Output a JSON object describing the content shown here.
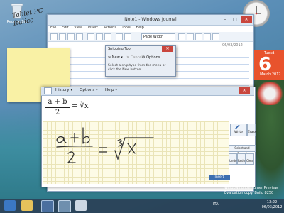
{
  "desktop": {
    "recycle_bin_label": "Recycle Bin",
    "sticky_note": [
      "Tablet PC",
      "Italico"
    ]
  },
  "journal": {
    "title": "Note1 - Windows Journal",
    "menu": [
      "File",
      "Edit",
      "View",
      "Insert",
      "Actions",
      "Tools",
      "Help"
    ],
    "zoom": "Page Width",
    "date": "06/03/2012"
  },
  "snipping_tool": {
    "title": "Snipping Tool",
    "new_label": "New",
    "cancel_label": "Cancel",
    "options_label": "Options",
    "description": "Select a snip type from the menu or click the New button."
  },
  "math_input": {
    "menu": [
      "History",
      "Options",
      "Help"
    ],
    "preview": {
      "numerator": "a + b",
      "denominator": "2",
      "rhs": "= ∛x"
    },
    "write_label": "Write",
    "erase_label": "Erase",
    "select_correct_label": "Select and Correct",
    "undo_label": "Undo",
    "redo_label": "Redo",
    "clear_label": "Clear",
    "insert_label": "Insert"
  },
  "calendar": {
    "day": "Tuesd.",
    "number": "6",
    "month": "March 2012"
  },
  "watermark": {
    "line1": "Windows 8 Consumer Preview",
    "line2": "Evaluation copy. Build 8250"
  },
  "taskbar": {
    "time": "13:22",
    "date": "06/03/2012",
    "tray_lang": "ITA"
  }
}
